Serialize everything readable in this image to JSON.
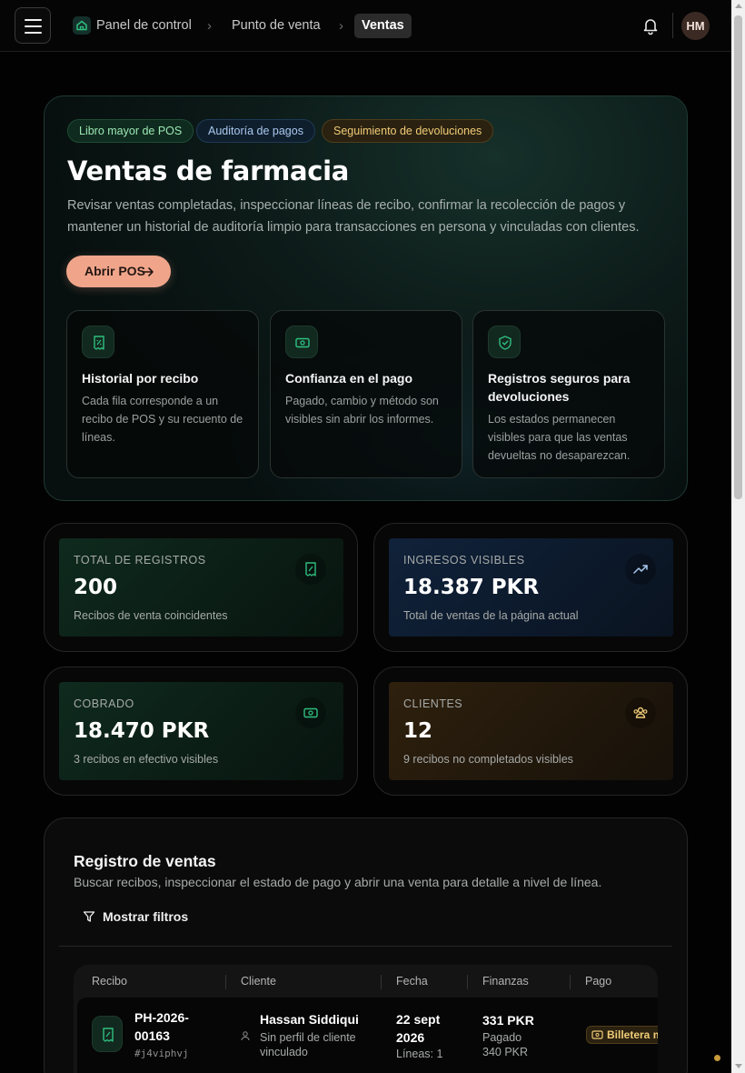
{
  "breadcrumb": {
    "home": "Panel de control",
    "section": "Punto de venta",
    "current": "Ventas"
  },
  "user": {
    "initials": "HM"
  },
  "hero": {
    "tags": [
      "Libro mayor de POS",
      "Auditoría de pagos",
      "Seguimiento de devoluciones"
    ],
    "title": "Ventas de farmacia",
    "description": "Revisar ventas completadas, inspeccionar líneas de recibo, confirmar la recolección de pagos y mantener un historial de auditoría limpio para transacciones en persona y vinculadas con clientes.",
    "cta_label": "Abrir POS",
    "features": [
      {
        "icon": "receipt-icon",
        "title": "Historial por recibo",
        "description": "Cada fila corresponde a un recibo de POS y su recuento de líneas."
      },
      {
        "icon": "banknote-icon",
        "title": "Confianza en el pago",
        "description": "Pagado, cambio y método son visibles sin abrir los informes."
      },
      {
        "icon": "shield-check-icon",
        "title": "Registros seguros para devoluciones",
        "description": "Los estados permanecen visibles para que las ventas devueltas no desaparezcan."
      }
    ]
  },
  "stats": [
    {
      "label": "TOTAL DE REGISTROS",
      "value": "200",
      "sub": "Recibos de venta coincidentes",
      "icon": "receipt-icon",
      "color": "#0e2219"
    },
    {
      "label": "INGRESOS VISIBLES",
      "value": "18.387 PKR",
      "sub": "Total de ventas de la página actual",
      "icon": "trending-up-icon",
      "color": "#0f1b2a"
    },
    {
      "label": "COBRADO",
      "value": "18.470 PKR",
      "sub": "3 recibos en efectivo visibles",
      "icon": "banknote-icon",
      "color": "#0e2219"
    },
    {
      "label": "CLIENTES",
      "value": "12",
      "sub": "9 recibos no completados visibles",
      "icon": "users-icon",
      "color": "#241a0d"
    }
  ],
  "register": {
    "title": "Registro de ventas",
    "description": "Buscar recibos, inspeccionar el estado de pago y abrir una venta para detalle a nivel de línea.",
    "filters_label": "Mostrar filtros",
    "columns": [
      "Recibo",
      "Cliente",
      "Fecha",
      "Finanzas",
      "Pago"
    ],
    "rows": [
      {
        "receipt_line1": "PH-2026-",
        "receipt_line2": "00163",
        "receipt_code": "#j4viphvj",
        "customer": "Hassan Siddiqui",
        "customer_note_line1": "Sin perfil de cliente",
        "customer_note_line2": "vinculado",
        "date_line1": "22 sept",
        "date_line2": "2026",
        "lines": "Líneas: 1",
        "amount": "331 PKR",
        "paid_label": "Pagado",
        "paid_amount": "340 PKR",
        "payment": "Billetera m"
      }
    ]
  },
  "colors": {
    "accent": "#f0a58b",
    "green": "#2fbf7f",
    "amber": "#f1cc78",
    "blue": "#a9c9ee"
  }
}
